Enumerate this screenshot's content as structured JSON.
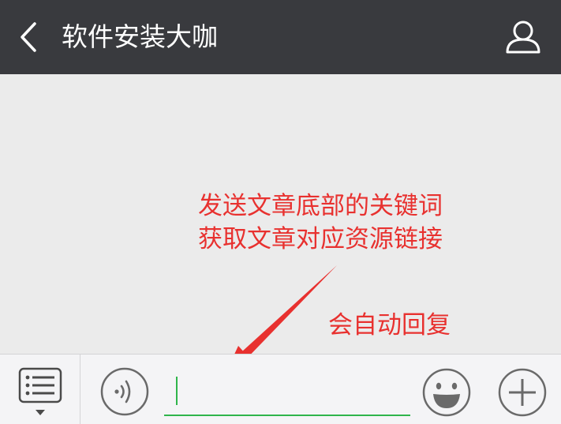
{
  "header": {
    "title": "软件安装大咖",
    "back_icon": "chevron-left-icon",
    "profile_icon": "person-icon"
  },
  "annotation": {
    "line1": "发送文章底部的关键词",
    "line2": "获取文章对应资源链接",
    "line3": "会自动回复",
    "color": "#e8312f"
  },
  "input_bar": {
    "menu_icon": "list-menu-icon",
    "voice_icon": "voice-icon",
    "emoji_icon": "smiley-icon",
    "plus_icon": "plus-icon",
    "input_value": "",
    "accent_color": "#2fb54b"
  },
  "colors": {
    "header_bg": "#393a3e",
    "chat_bg": "#ebebeb",
    "bar_bg": "#f4f4f6"
  }
}
